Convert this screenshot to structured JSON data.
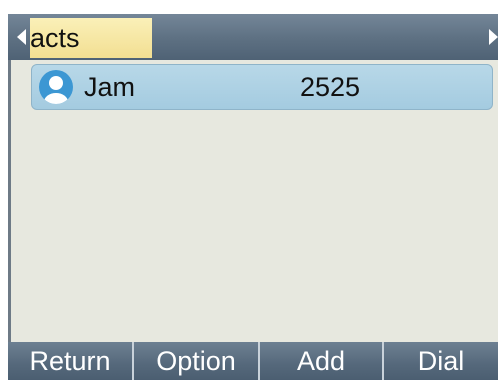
{
  "title": {
    "text": "acts"
  },
  "contacts": [
    {
      "name": "Jam",
      "number": "2525",
      "icon": "person-avatar-icon"
    }
  ],
  "softkeys": {
    "return_label": "Return",
    "option_label": "Option",
    "add_label": "Add",
    "dial_label": "Dial"
  },
  "colors": {
    "title_bar": "#5d7082",
    "title_highlight": "#f3df92",
    "selected_row": "#a4cbe0",
    "background": "#e7e8df",
    "softkey_bar": "#55687b",
    "avatar": "#3c97d3"
  }
}
